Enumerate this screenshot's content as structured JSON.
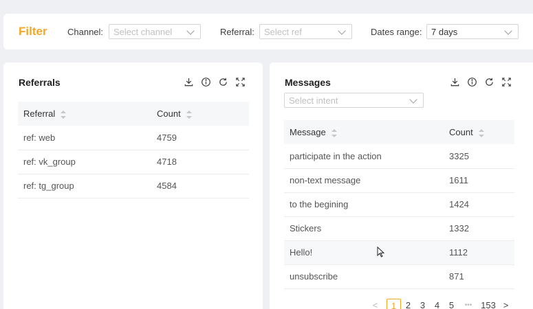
{
  "filter": {
    "title": "Filter",
    "channel_label": "Channel:",
    "channel_placeholder": "Select channel",
    "referral_label": "Referral:",
    "referral_placeholder": "Select ref",
    "dates_label": "Dates range:",
    "dates_value": "7 days"
  },
  "referrals": {
    "title": "Referrals",
    "columns": [
      "Referral",
      "Count"
    ],
    "rows": [
      {
        "name": "ref: web",
        "count": "4759"
      },
      {
        "name": "ref: vk_group",
        "count": "4718"
      },
      {
        "name": "ref: tg_group",
        "count": "4584"
      }
    ]
  },
  "messages": {
    "title": "Messages",
    "intent_placeholder": "Select intent",
    "columns": [
      "Message",
      "Count"
    ],
    "rows": [
      {
        "name": "participate in the action",
        "count": "3325"
      },
      {
        "name": "non-text message",
        "count": "1611"
      },
      {
        "name": "to the begining",
        "count": "1424"
      },
      {
        "name": "Stickers",
        "count": "1332"
      },
      {
        "name": "Hello!",
        "count": "1112"
      },
      {
        "name": "unsubscribe",
        "count": "871"
      }
    ],
    "pagination": {
      "prev": "<",
      "pages": [
        "1",
        "2",
        "3",
        "4",
        "5"
      ],
      "ellipsis": "•••",
      "last": "153",
      "next": ">",
      "current": "1"
    }
  },
  "icons": [
    "download-icon",
    "info-icon",
    "refresh-icon",
    "fullscreen-icon"
  ],
  "colors": {
    "accent": "#f5a623",
    "background": "#eff0f4"
  }
}
